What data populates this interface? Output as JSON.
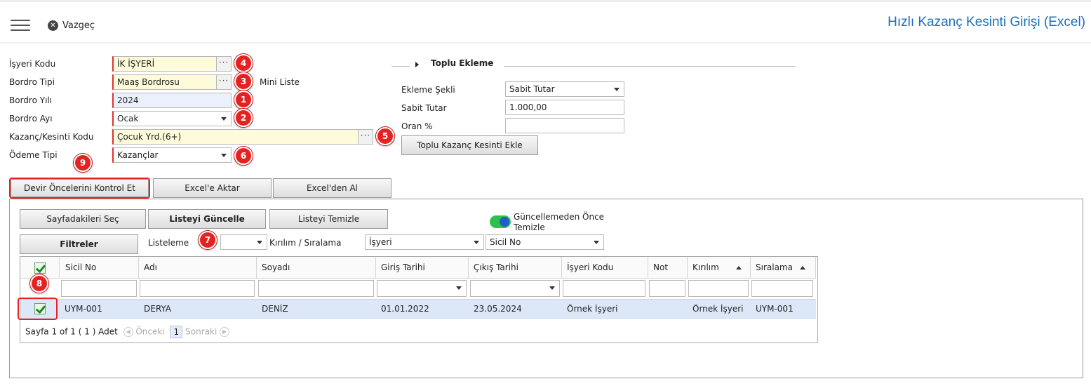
{
  "header": {
    "cancel_label": "Vazgeç",
    "title": "Hızlı Kazanç Kesinti Girişi (Excel)"
  },
  "form": {
    "employer_code": {
      "label": "İşyeri Kodu",
      "value": "İK İŞYERİ",
      "badge": "4"
    },
    "payroll_type": {
      "label": "Bordro Tipi",
      "value": "Maaş Bordrosu",
      "badge": "3",
      "mini_list_label": "Mini Liste"
    },
    "payroll_year": {
      "label": "Bordro Yılı",
      "value": "2024",
      "badge": "1"
    },
    "payroll_month": {
      "label": "Bordro Ayı",
      "value": "Ocak",
      "badge": "2"
    },
    "earning_code": {
      "label": "Kazanç/Kesinti Kodu",
      "value": "Çocuk Yrd.(6+)",
      "badge": "5"
    },
    "payment_type": {
      "label": "Ödeme Tipi",
      "value": "Kazançlar",
      "badge": "6"
    },
    "badge_9": "9",
    "dots": "···"
  },
  "bulk": {
    "title": "Toplu Ekleme",
    "method_label": "Ekleme Şekli",
    "method_value": "Sabit Tutar",
    "fixed_label": "Sabit Tutar",
    "fixed_value": "1.000,00",
    "rate_label": "Oran %",
    "rate_value": "",
    "add_button": "Toplu Kazanç Kesinti Ekle"
  },
  "actions": {
    "check_previous": "Devir Öncelerini Kontrol Et",
    "export_excel": "Excel'e Aktar",
    "import_excel": "Excel'den Al"
  },
  "panel": {
    "select_page": "Sayfadakileri Seç",
    "refresh_list": "Listeyi Güncelle",
    "clear_list": "Listeyi Temizle",
    "clear_before_update": "Güncellemeden Önce Temizle",
    "filters": "Filtreler",
    "listing_label": "Listeleme",
    "listing_value": "",
    "breakdown_label": "Kırılım / Sıralama",
    "breakdown_value": "İşyeri",
    "sort_value": "Sicil No",
    "badge_7": "7"
  },
  "grid": {
    "columns": [
      "Sicil No",
      "Adı",
      "Soyadı",
      "Giriş Tarihi",
      "Çıkış Tarihi",
      "İşyeri Kodu",
      "Not",
      "Kırılım",
      "Sıralama"
    ],
    "badge_8": "8",
    "rows": [
      {
        "sicil": "UYM-001",
        "ad": "DERYA",
        "soyad": "DENİZ",
        "giris": "01.01.2022",
        "cikis": "23.05.2024",
        "isyeri": "Örnek İşyeri",
        "not": "",
        "kirilim": "Örnek İşyeri",
        "siralama": "UYM-001"
      }
    ],
    "pager": {
      "summary": "Sayfa 1 of 1 ( 1 ) Adet",
      "prev": "Önceki",
      "page": "1",
      "next": "Sonraki"
    }
  }
}
